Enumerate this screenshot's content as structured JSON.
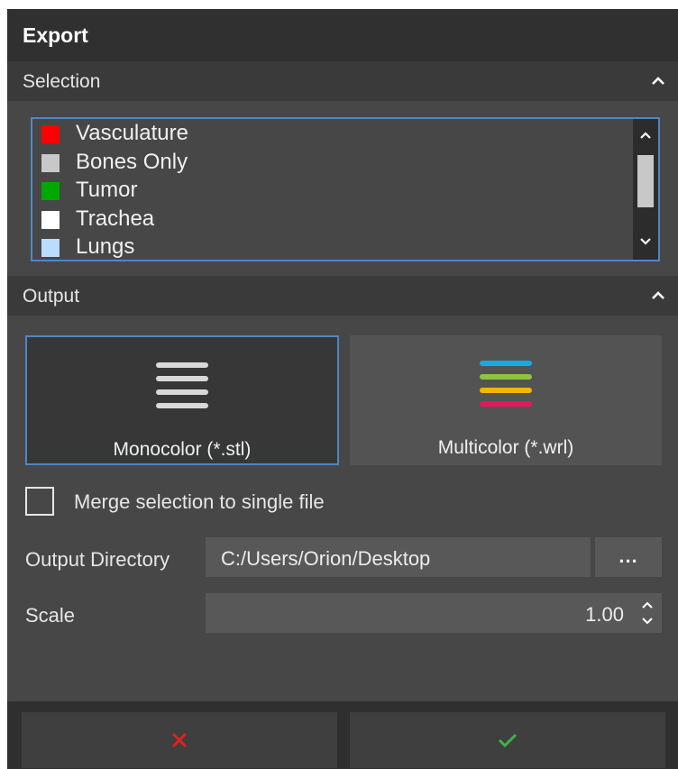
{
  "window": {
    "title": "Export"
  },
  "selection": {
    "header": "Selection",
    "items": [
      {
        "label": "Vasculature",
        "color": "#ff0000"
      },
      {
        "label": "Bones Only",
        "color": "#c8c8c8"
      },
      {
        "label": "Tumor",
        "color": "#00a800"
      },
      {
        "label": "Trachea",
        "color": "#ffffff"
      },
      {
        "label": "Lungs",
        "color": "#bcdcff"
      }
    ]
  },
  "output": {
    "header": "Output",
    "mono_label": "Monocolor (*.stl)",
    "multi_label": "Multicolor (*.wrl)",
    "selected_format": "Monocolor (*.stl)",
    "multi_icon_colors": [
      "#1aa7e6",
      "#8cc63f",
      "#f7b500",
      "#e8175d"
    ],
    "merge_label": "Merge selection to single file",
    "merge_checked": false,
    "directory_label": "Output Directory",
    "directory_value": "C:/Users/Orion/Desktop",
    "browse_label": "...",
    "scale_label": "Scale",
    "scale_value": "1.00"
  },
  "footer": {
    "cancel_icon": "close-icon",
    "confirm_icon": "check-icon"
  },
  "colors": {
    "accent": "#4f86c6",
    "cancel": "#e02020",
    "confirm": "#3cb34a"
  }
}
